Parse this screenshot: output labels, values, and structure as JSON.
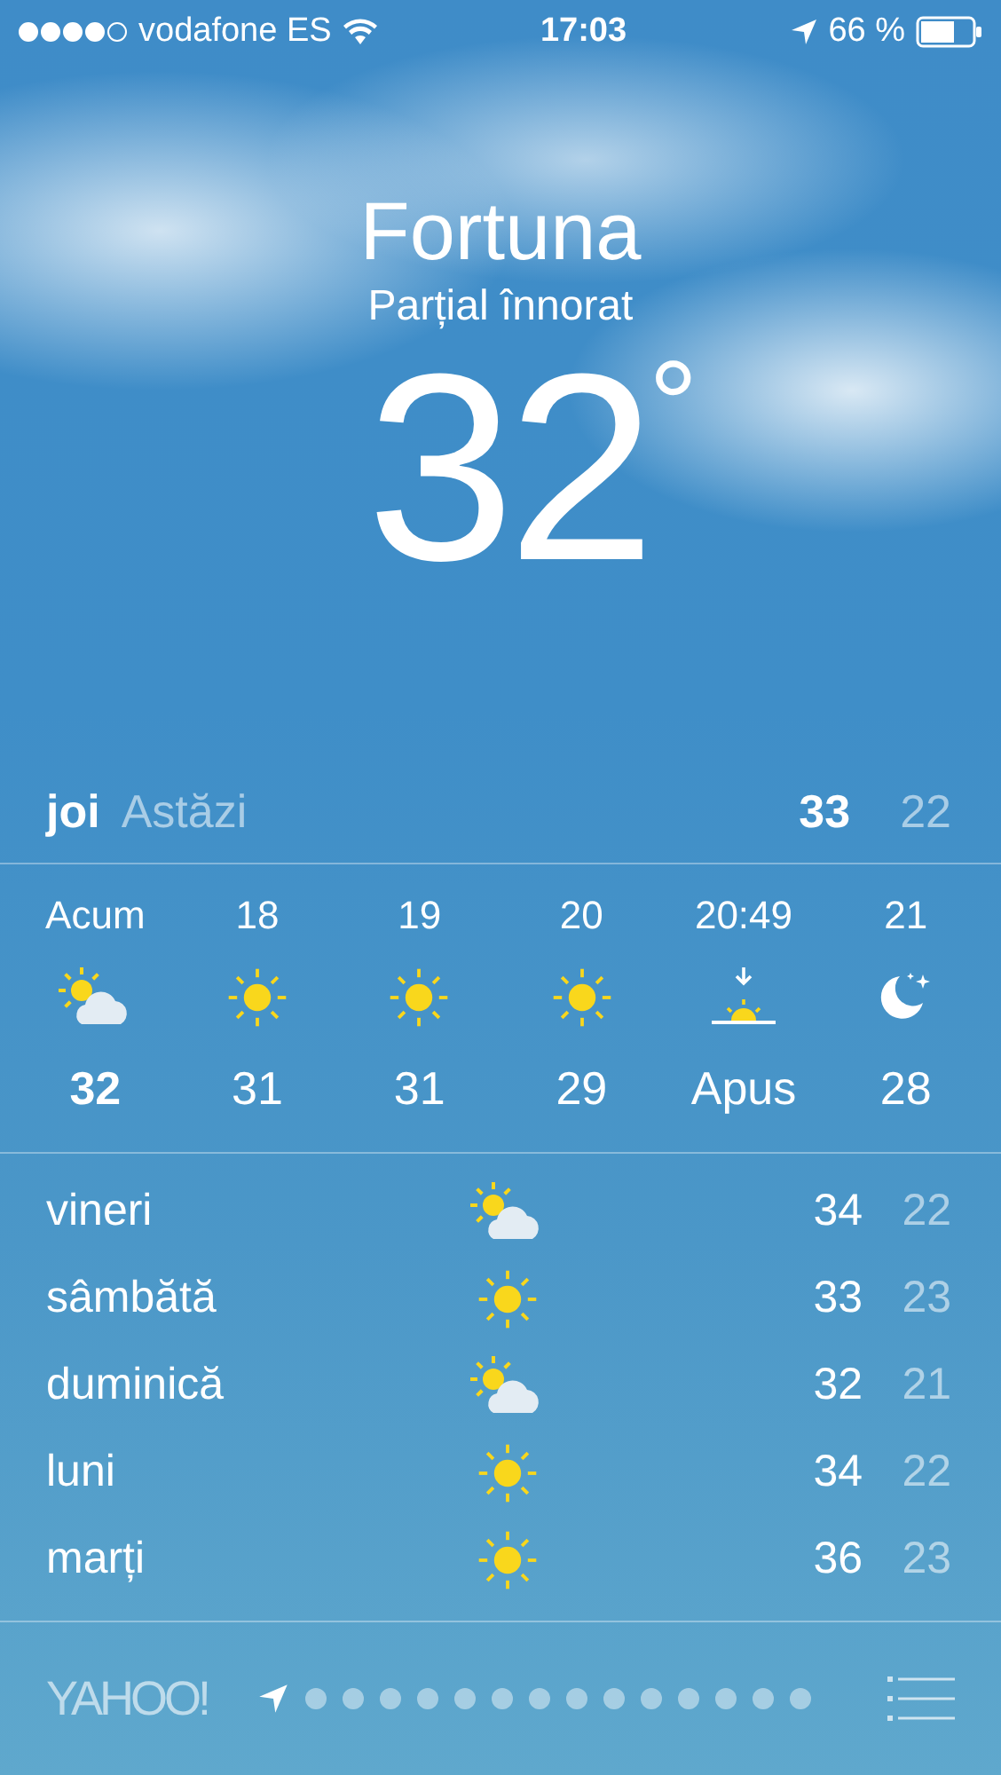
{
  "status_bar": {
    "carrier": "vodafone ES",
    "time": "17:03",
    "battery": "66 %"
  },
  "location": {
    "city": "Fortuna",
    "condition": "Parțial înnorat",
    "temperature": "32",
    "degree": "°"
  },
  "today": {
    "day": "joi",
    "label": "Astăzi",
    "high": "33",
    "low": "22"
  },
  "hourly": [
    {
      "time": "Acum",
      "kind": "cloudy",
      "value": "32",
      "current": true
    },
    {
      "time": "18",
      "kind": "sunny",
      "value": "31",
      "current": false
    },
    {
      "time": "19",
      "kind": "sunny",
      "value": "31",
      "current": false
    },
    {
      "time": "20",
      "kind": "sunny",
      "value": "29",
      "current": false
    },
    {
      "time": "20:49",
      "kind": "sunset",
      "value": "Apus",
      "current": false
    },
    {
      "time": "21",
      "kind": "night",
      "value": "28",
      "current": false
    }
  ],
  "daily": [
    {
      "day": "vineri",
      "kind": "cloudy",
      "high": "34",
      "low": "22"
    },
    {
      "day": "sâmbătă",
      "kind": "sunny",
      "high": "33",
      "low": "23"
    },
    {
      "day": "duminică",
      "kind": "cloudy",
      "high": "32",
      "low": "21"
    },
    {
      "day": "luni",
      "kind": "sunny",
      "high": "34",
      "low": "22"
    },
    {
      "day": "marți",
      "kind": "sunny",
      "high": "36",
      "low": "23"
    }
  ],
  "footer": {
    "logo": "YAHOO!",
    "pages": [
      {
        "kind": "location",
        "selected": true
      },
      {
        "kind": "dot",
        "selected": false
      },
      {
        "kind": "dot",
        "selected": false
      },
      {
        "kind": "dot",
        "selected": false
      },
      {
        "kind": "dot",
        "selected": false
      },
      {
        "kind": "dot",
        "selected": false
      },
      {
        "kind": "dot",
        "selected": false
      },
      {
        "kind": "dot",
        "selected": false
      },
      {
        "kind": "dot",
        "selected": false
      },
      {
        "kind": "dot",
        "selected": false
      },
      {
        "kind": "dot",
        "selected": false
      },
      {
        "kind": "dot",
        "selected": false
      },
      {
        "kind": "dot",
        "selected": false
      },
      {
        "kind": "dot",
        "selected": false
      },
      {
        "kind": "dot",
        "selected": false
      }
    ]
  }
}
